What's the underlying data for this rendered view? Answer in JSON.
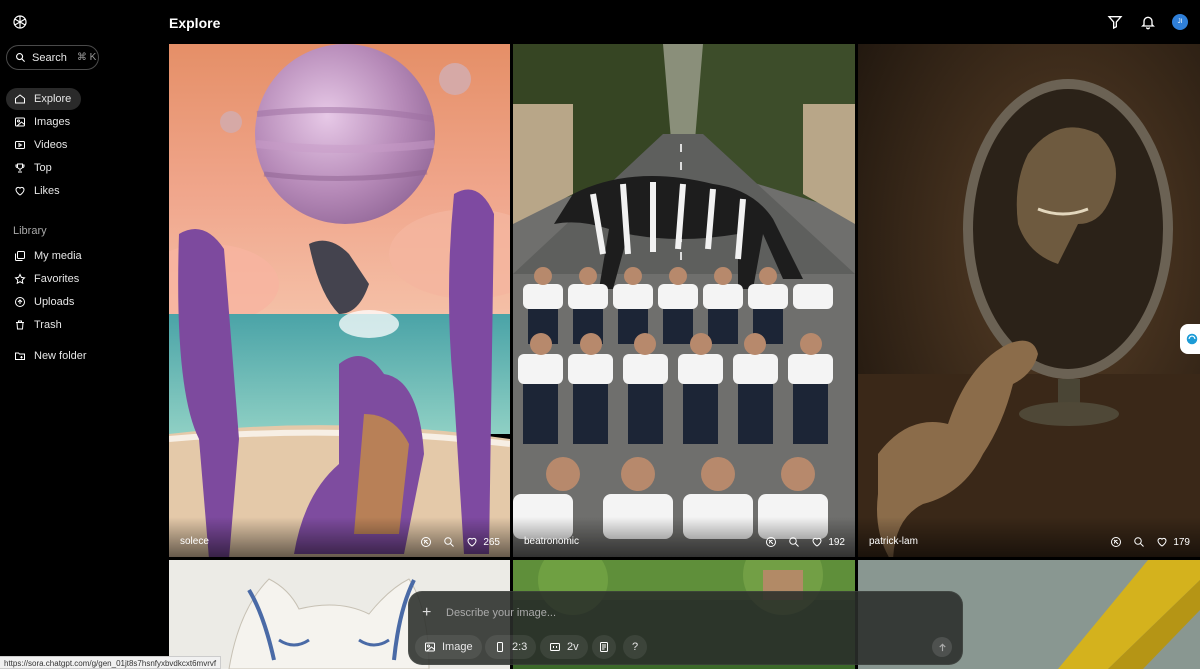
{
  "header": {
    "title": "Explore"
  },
  "search": {
    "label": "Search",
    "shortcut": "⌘ K"
  },
  "nav": [
    {
      "label": "Explore",
      "icon": "compass-icon",
      "active": true
    },
    {
      "label": "Images",
      "icon": "image-icon"
    },
    {
      "label": "Videos",
      "icon": "video-icon"
    },
    {
      "label": "Top",
      "icon": "trophy-icon"
    },
    {
      "label": "Likes",
      "icon": "heart-icon"
    }
  ],
  "library": {
    "title": "Library",
    "items": [
      {
        "label": "My media",
        "icon": "media-icon"
      },
      {
        "label": "Favorites",
        "icon": "star-icon"
      },
      {
        "label": "Uploads",
        "icon": "upload-icon"
      },
      {
        "label": "Trash",
        "icon": "trash-icon"
      }
    ],
    "new_folder": "New folder"
  },
  "header_icons": [
    "filter-icon",
    "bell-icon"
  ],
  "avatar": {
    "initials": "JI"
  },
  "tiles": [
    {
      "user": "solece",
      "likes": "265"
    },
    {
      "user": "beatronomic",
      "likes": "192"
    },
    {
      "user": "patrick-lam",
      "likes": "179"
    }
  ],
  "composer": {
    "placeholder": "Describe your image...",
    "type_label": "Image",
    "aspect_label": "2:3",
    "variations_label": "2v",
    "help_label": "?"
  },
  "statusbar": {
    "url": "https://sora.chatgpt.com/g/gen_01jt8s7hsnfyxbvdkcxt6mvrvf"
  },
  "colors": {
    "background": "#000000",
    "accent": "#2f7fd8"
  }
}
